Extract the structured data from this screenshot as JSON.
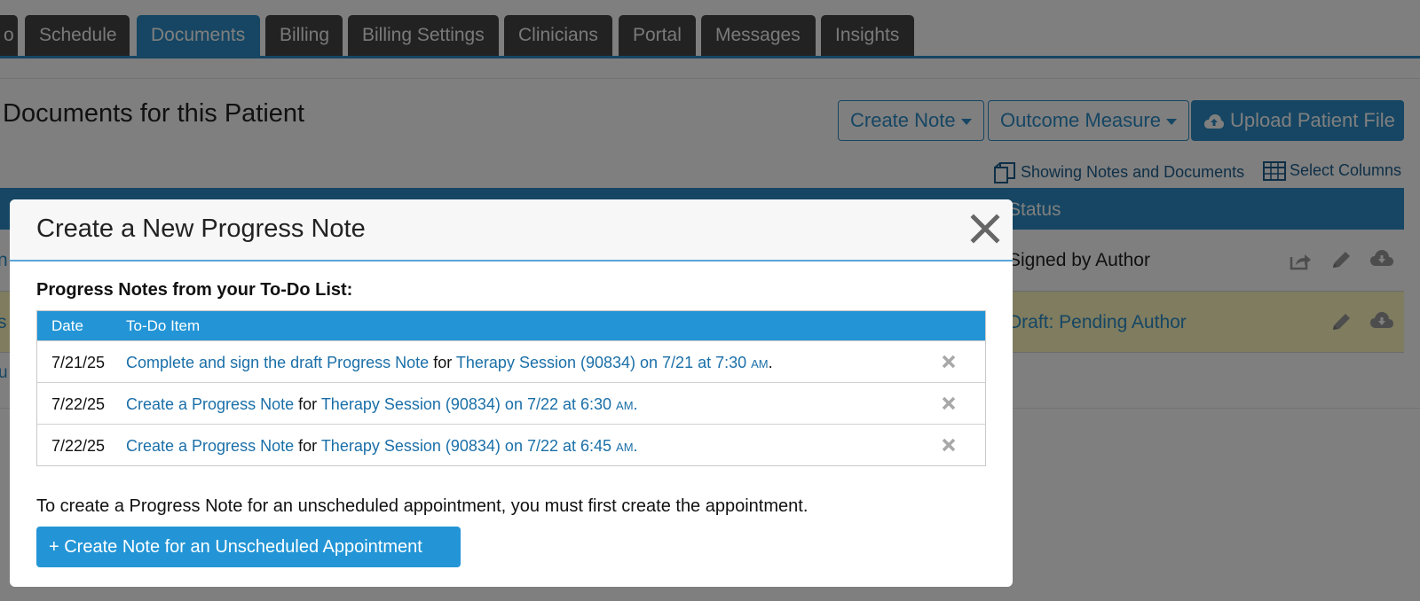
{
  "nav": {
    "tabs": [
      {
        "label": "o"
      },
      {
        "label": "Schedule"
      },
      {
        "label": "Documents"
      },
      {
        "label": "Billing"
      },
      {
        "label": "Billing Settings"
      },
      {
        "label": "Clinicians"
      },
      {
        "label": "Portal"
      },
      {
        "label": "Messages"
      },
      {
        "label": "Insights"
      }
    ],
    "active_tab": "Documents"
  },
  "page": {
    "title": "Documents for this Patient",
    "create_note_label": "Create Note",
    "outcome_measure_label": "Outcome Measure",
    "upload_label": "Upload Patient File",
    "showing_label": "Showing Notes and Documents",
    "select_columns_label": "Select Columns",
    "status_header": "Status",
    "rows": [
      {
        "status": "Signed by Author",
        "left_fragment": "n"
      },
      {
        "status": "Draft: Pending Author",
        "left_fragment": "s"
      }
    ],
    "below_fragment": "u"
  },
  "modal": {
    "title": "Create a New Progress Note",
    "section_label": "Progress Notes from your To-Do List:",
    "columns": {
      "date": "Date",
      "item": "To-Do Item"
    },
    "todos": [
      {
        "date": "7/21/25",
        "action": "Complete and sign the draft Progress Note",
        "for": "for",
        "session": "Therapy Session (90834) on 7/21 at 7:30",
        "ampm": "AM",
        "end": "."
      },
      {
        "date": "7/22/25",
        "action": "Create a Progress Note",
        "for": "for",
        "session": "Therapy Session (90834) on 7/22 at 6:30",
        "ampm": "AM",
        "end": "."
      },
      {
        "date": "7/22/25",
        "action": "Create a Progress Note",
        "for": "for",
        "session": "Therapy Session (90834) on 7/22 at 6:45",
        "ampm": "AM",
        "end": "."
      }
    ],
    "info_text": "To create a Progress Note for an unscheduled appointment, you must first create the appointment.",
    "primary_button": "+ Create Note for an Unscheduled Appointment"
  },
  "colors": {
    "accent": "#2d8cc7",
    "table_head": "#2395d6",
    "draft_row": "#fff9bf",
    "tab_bg": "#454545"
  },
  "icons": [
    "upload-cloud-icon",
    "documents-icon",
    "table-grid-icon",
    "share-icon",
    "pencil-icon",
    "download-cloud-icon",
    "close-icon",
    "remove-icon"
  ]
}
